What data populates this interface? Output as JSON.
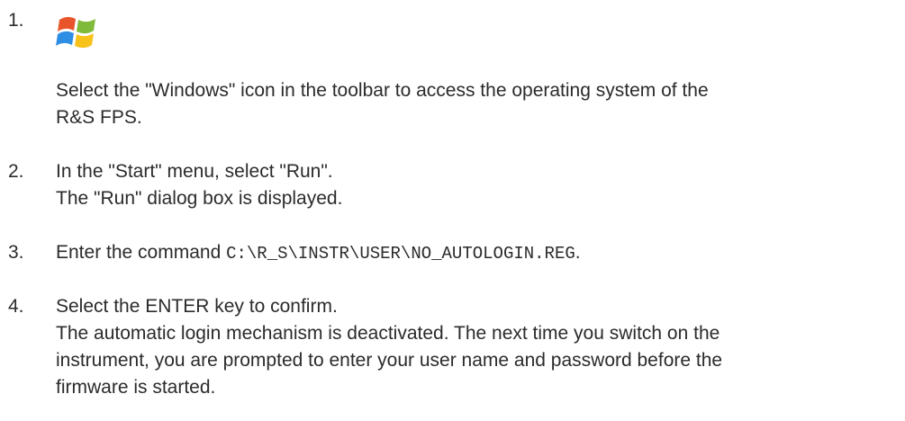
{
  "steps": [
    {
      "number": "1.",
      "icon": "windows-logo-icon",
      "lines": [
        "Select the \"Windows\" icon in the toolbar to access the operating system of the",
        "R&S FPS."
      ]
    },
    {
      "number": "2.",
      "lines": [
        "In the \"Start\" menu, select \"Run\".",
        "The \"Run\" dialog box is displayed."
      ]
    },
    {
      "number": "3.",
      "text_before": "Enter the command ",
      "command": "C:\\R_S\\INSTR\\USER\\NO_AUTOLOGIN.REG",
      "text_after": "."
    },
    {
      "number": "4.",
      "lines": [
        "Select the ENTER key to confirm.",
        "The automatic login mechanism is deactivated. The next time you switch on the",
        "instrument, you are prompted to enter your user name and password before the",
        "firmware is started."
      ]
    }
  ]
}
